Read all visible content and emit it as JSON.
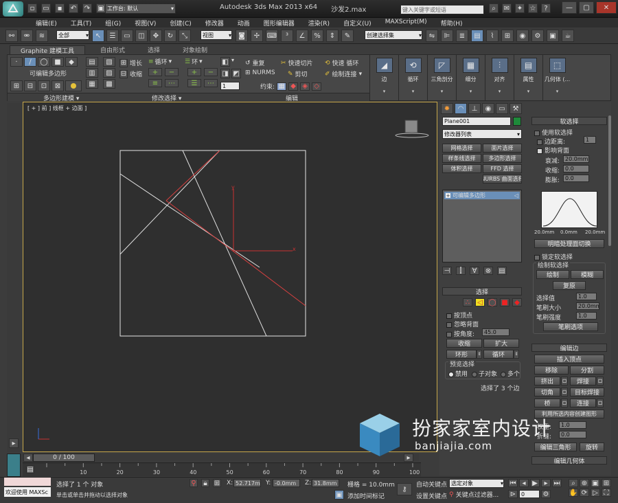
{
  "titlebar": {
    "workspace_label": "工作台: 默认",
    "title": "Autodesk 3ds Max  2013 x64",
    "filename": "沙发2.max",
    "search_placeholder": "键入关键字或短语"
  },
  "menu": [
    "编辑(E)",
    "工具(T)",
    "组(G)",
    "视图(V)",
    "创建(C)",
    "修改器",
    "动画",
    "图形编辑器",
    "渲染(R)",
    "自定义(U)",
    "MAXScript(M)",
    "帮助(H)"
  ],
  "main_toolbar": {
    "filter_value": "全部",
    "refcoord_value": "视图",
    "named_selset_placeholder": "创建选择集"
  },
  "ribbon": {
    "tabs": [
      "Graphite 建模工具",
      "自由形式",
      "选择",
      "对象绘制"
    ],
    "poly_modeling": {
      "label": "可编辑多边形",
      "footer": "多边形建模"
    },
    "modify_selection": {
      "grow": "增长",
      "shrink": "收缩",
      "loop": "循环",
      "ring": "环",
      "footer": "修改选择"
    },
    "edit": {
      "repeat": "重复",
      "quickslice": "快速切片",
      "quickloop": "快速 循环",
      "nurms": "NURMS",
      "cut": "剪切",
      "paintconnect": "绘制连接",
      "constraints": "约束:",
      "footer": "编辑",
      "spinner": "1"
    },
    "big_buttons": [
      "边",
      "循环",
      "三角剖分",
      "细分",
      "对齐",
      "属性",
      "几何体 (..."
    ]
  },
  "viewport": {
    "label": "[ + ] 前 ] 线框 + 边面 ]",
    "axis_x": "x",
    "axis_y": "y"
  },
  "timeline": {
    "slider_label": "0 / 100",
    "ticks": [
      "10",
      "20",
      "30",
      "40",
      "50",
      "60",
      "70",
      "80",
      "90",
      "100"
    ]
  },
  "statusbar": {
    "welcome": "欢迎使用 MAXSc",
    "selected": "选择了 1 个 对象",
    "prompt": "单击或单击并拖动以选择对象",
    "x_label": "X:",
    "x_value": "52.717mm",
    "y_label": "Y:",
    "y_value": "-0.0mm",
    "z_label": "Z:",
    "z_value": "31.8mm",
    "grid": "栅格 = 10.0mm",
    "autokey": "自动关键点",
    "setkey": "设置关键点",
    "selected_object": "选定对象",
    "addtime": "添加时间标记",
    "keyfilters": "关键点过滤器...",
    "frame": "0"
  },
  "cmdpanel": {
    "object_name": "Plane001",
    "modifier_list": "修改器列表",
    "sets": [
      "网格选择",
      "面片选择",
      "样条线选择",
      "多边形选择",
      "体积选择",
      "FFD 选择",
      "NURBS 曲面选择"
    ],
    "stack_item": "可编辑多边形",
    "selection_title": "选择",
    "by_vertex": "按顶点",
    "ignore_backfacing": "忽略背面",
    "by_angle": "按角度:",
    "angle_value": "45.0",
    "shrink": "收缩",
    "grow": "扩大",
    "ring": "环形",
    "loop": "循环",
    "preview_title": "预览选择",
    "preview_options": [
      "禁用",
      "子对象",
      "多个"
    ],
    "status": "选择了 3 个边"
  },
  "softsel": {
    "title": "软选择",
    "use": "使用软选择",
    "edge_distance": "边距离:",
    "edge_distance_value": "1",
    "affect_back": "影响背面",
    "falloff_label": "衰减:",
    "falloff_value": "20.0mm",
    "pinch_label": "收缩:",
    "pinch_value": "0.0",
    "bubble_label": "膨胀:",
    "bubble_value": "0.0",
    "curve_labels": [
      "20.0mm",
      "0.0mm",
      "20.0mm"
    ],
    "shaded_face": "明暗处理面切换",
    "lock": "锁定软选择",
    "paint_title": "绘制软选择",
    "paint": "绘制",
    "blur": "模糊",
    "revert": "复原",
    "select_value_label": "选择值",
    "select_value": "1.0",
    "brush_size_label": "笔刷大小",
    "brush_size": "20.0mm",
    "brush_strength_label": "笔刷强度",
    "brush_strength": "1.0",
    "brush_options": "笔刷选项"
  },
  "editedges": {
    "title": "编辑边",
    "insert_vertex": "插入顶点",
    "remove": "移除",
    "split": "分割",
    "extrude": "挤出",
    "weld": "焊接",
    "chamfer": "切角",
    "target_weld": "目标焊接",
    "bridge": "桥",
    "connect": "连接",
    "create_shape": "利用所选内容创建图形",
    "weight_label": "权重:",
    "weight_value": "1.0",
    "crease_label": "折缝:",
    "crease_value": "0.0",
    "edit_tri": "编辑三角形",
    "turn": "旋转",
    "geometry_title": "编辑几何体"
  },
  "watermark": {
    "cn": "扮家家室内设计",
    "url": "banjiajia.com"
  }
}
